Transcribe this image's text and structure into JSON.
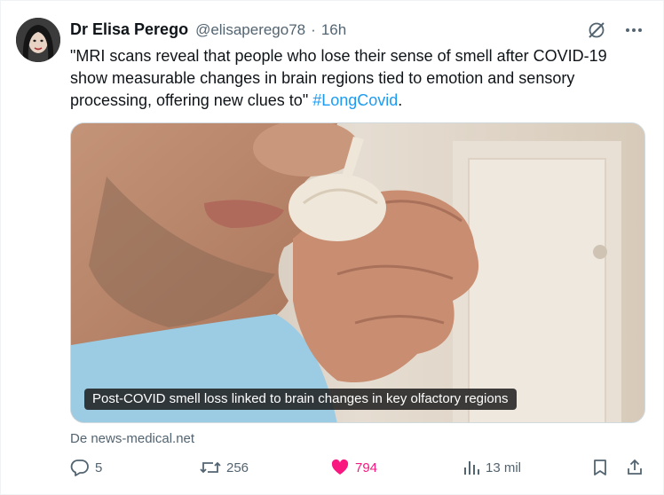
{
  "author": {
    "name": "Dr Elisa Perego",
    "handle": "@elisaperego78",
    "separator": "·",
    "time": "16h"
  },
  "tweet": {
    "text": "\"MRI scans reveal that people who lose their sense of smell after COVID-19 show measurable changes in brain regions tied to emotion and sensory processing, offering new clues to\" ",
    "hashtag": "#LongCovid",
    "trailing": "."
  },
  "media": {
    "caption": "Post-COVID smell loss linked to brain changes in key olfactory regions"
  },
  "source": "De news-medical.net",
  "actions": {
    "replies": "5",
    "retweets": "256",
    "likes": "794",
    "views": "13 mil"
  },
  "icons": {
    "top": [
      "grok-icon",
      "more-icon"
    ],
    "bottom": [
      "reply-icon",
      "retweet-icon",
      "like-icon",
      "views-icon",
      "bookmark-icon",
      "share-icon"
    ]
  },
  "colors": {
    "text": "#0f1419",
    "secondary": "#536471",
    "link": "#1d9bf0",
    "like": "#f91880"
  }
}
